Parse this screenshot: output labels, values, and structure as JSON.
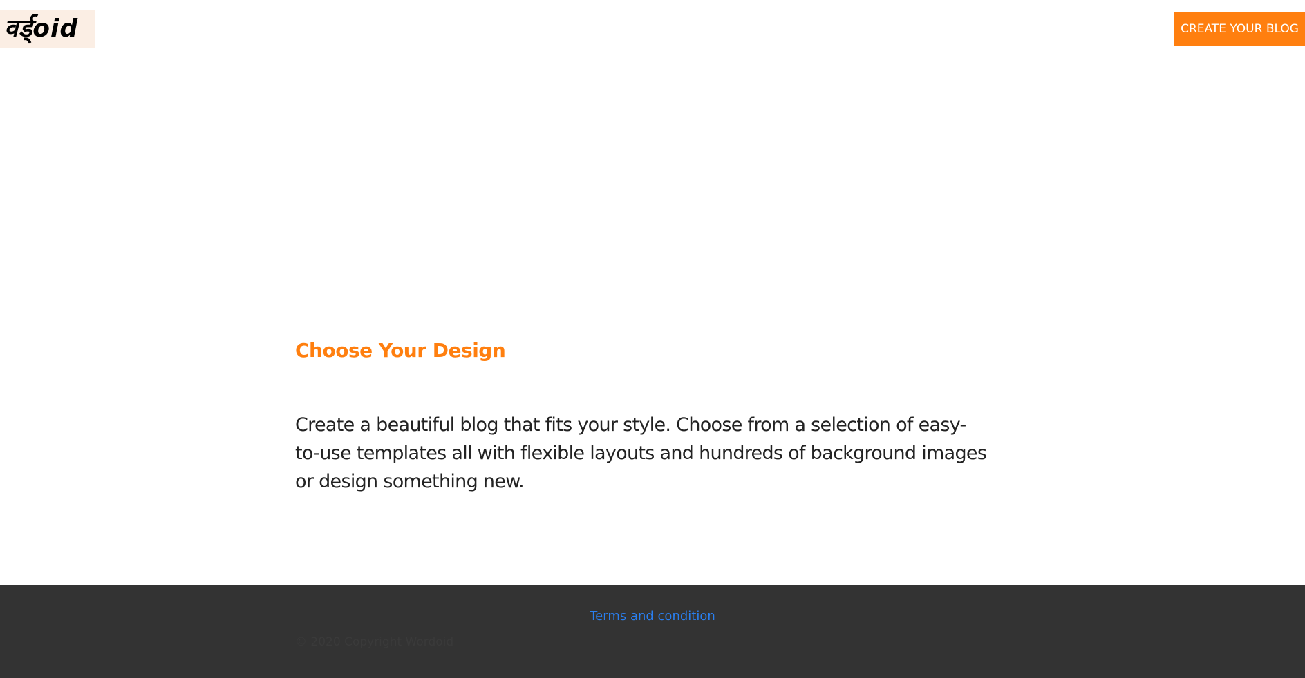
{
  "header": {
    "logo_text": "वर्ड्oid",
    "cta_label": "CREATE YOUR BLOG"
  },
  "main": {
    "title": "Choose Your Design",
    "body": "Create a beautiful blog that fits your style. Choose from a selection of easy-to-use templates all with flexible layouts and hundreds of background images or design something new."
  },
  "footer": {
    "link_label": "Terms and condition",
    "copyright": "© 2020 Copyright Wordoid"
  },
  "colors": {
    "accent": "#ff7f0f",
    "footer_bg": "#333333",
    "link": "#2a7ff0",
    "logo_bg": "#fbeee4"
  }
}
